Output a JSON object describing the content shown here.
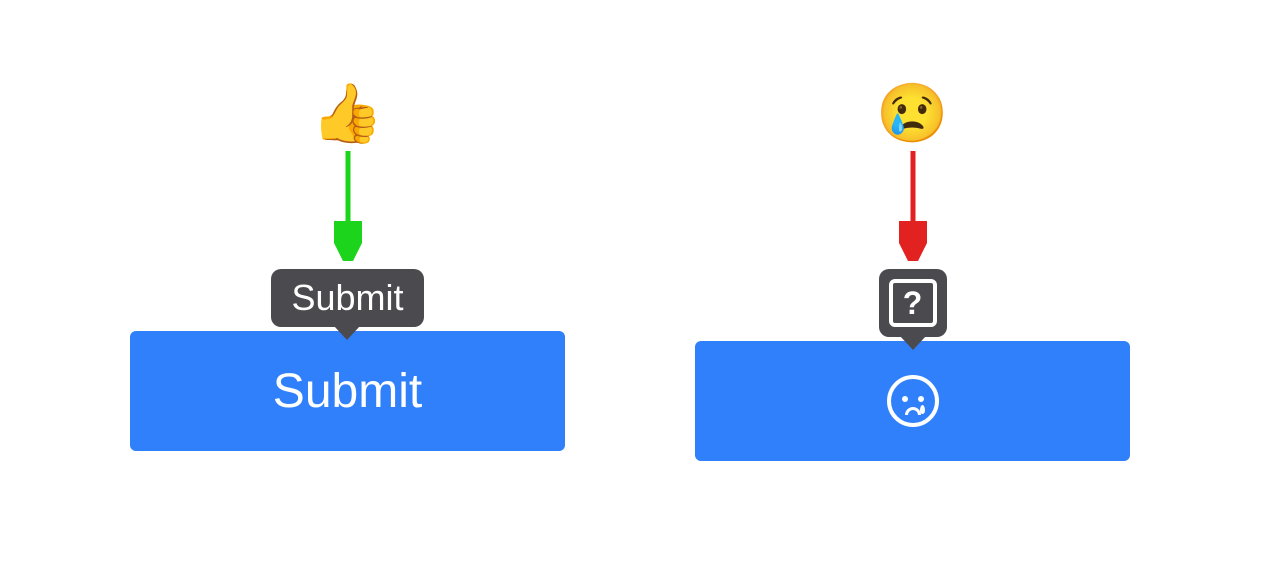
{
  "goodExample": {
    "emoji": "👍",
    "arrowColor": "#1bd41b",
    "tooltip": "Submit",
    "buttonLabel": "Submit"
  },
  "badExample": {
    "emoji": "😢",
    "arrowColor": "#e22121",
    "tooltipIcon": "?",
    "buttonIcon": "crying-face"
  }
}
